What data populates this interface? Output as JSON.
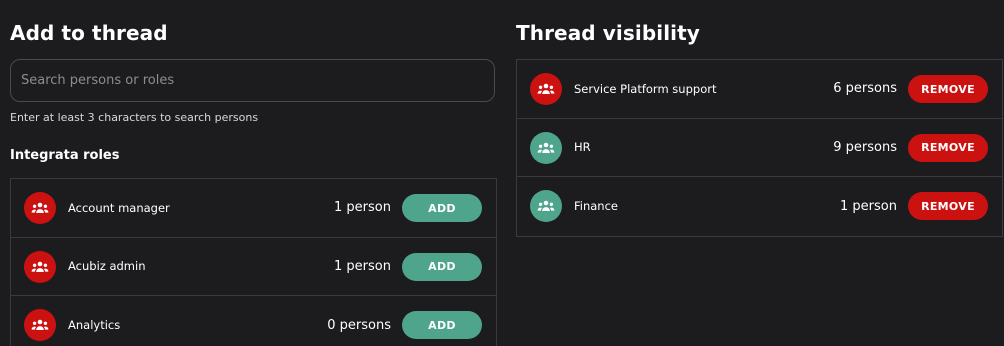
{
  "add_panel": {
    "title": "Add to thread",
    "search": {
      "placeholder": "Search persons or roles",
      "value": ""
    },
    "hint": "Enter at least 3 characters to search persons",
    "section_title": "Integrata roles",
    "button_label": "ADD",
    "roles": [
      {
        "name": "Account manager",
        "count": "1 person",
        "avatar_color": "#cc1111"
      },
      {
        "name": "Acubiz admin",
        "count": "1 person",
        "avatar_color": "#cc1111"
      },
      {
        "name": "Analytics",
        "count": "0 persons",
        "avatar_color": "#cc1111"
      }
    ]
  },
  "visibility_panel": {
    "title": "Thread visibility",
    "button_label": "REMOVE",
    "groups": [
      {
        "name": "Service Platform support",
        "count": "6 persons",
        "avatar_color": "#cc1111"
      },
      {
        "name": "HR",
        "count": "9 persons",
        "avatar_color": "#4ea58b"
      },
      {
        "name": "Finance",
        "count": "1 person",
        "avatar_color": "#4ea58b"
      }
    ]
  },
  "icons": {
    "avatar": "group-people-icon"
  },
  "colors": {
    "accent_red": "#cc1111",
    "accent_green": "#4ea58b",
    "background": "#1c1b1e"
  }
}
